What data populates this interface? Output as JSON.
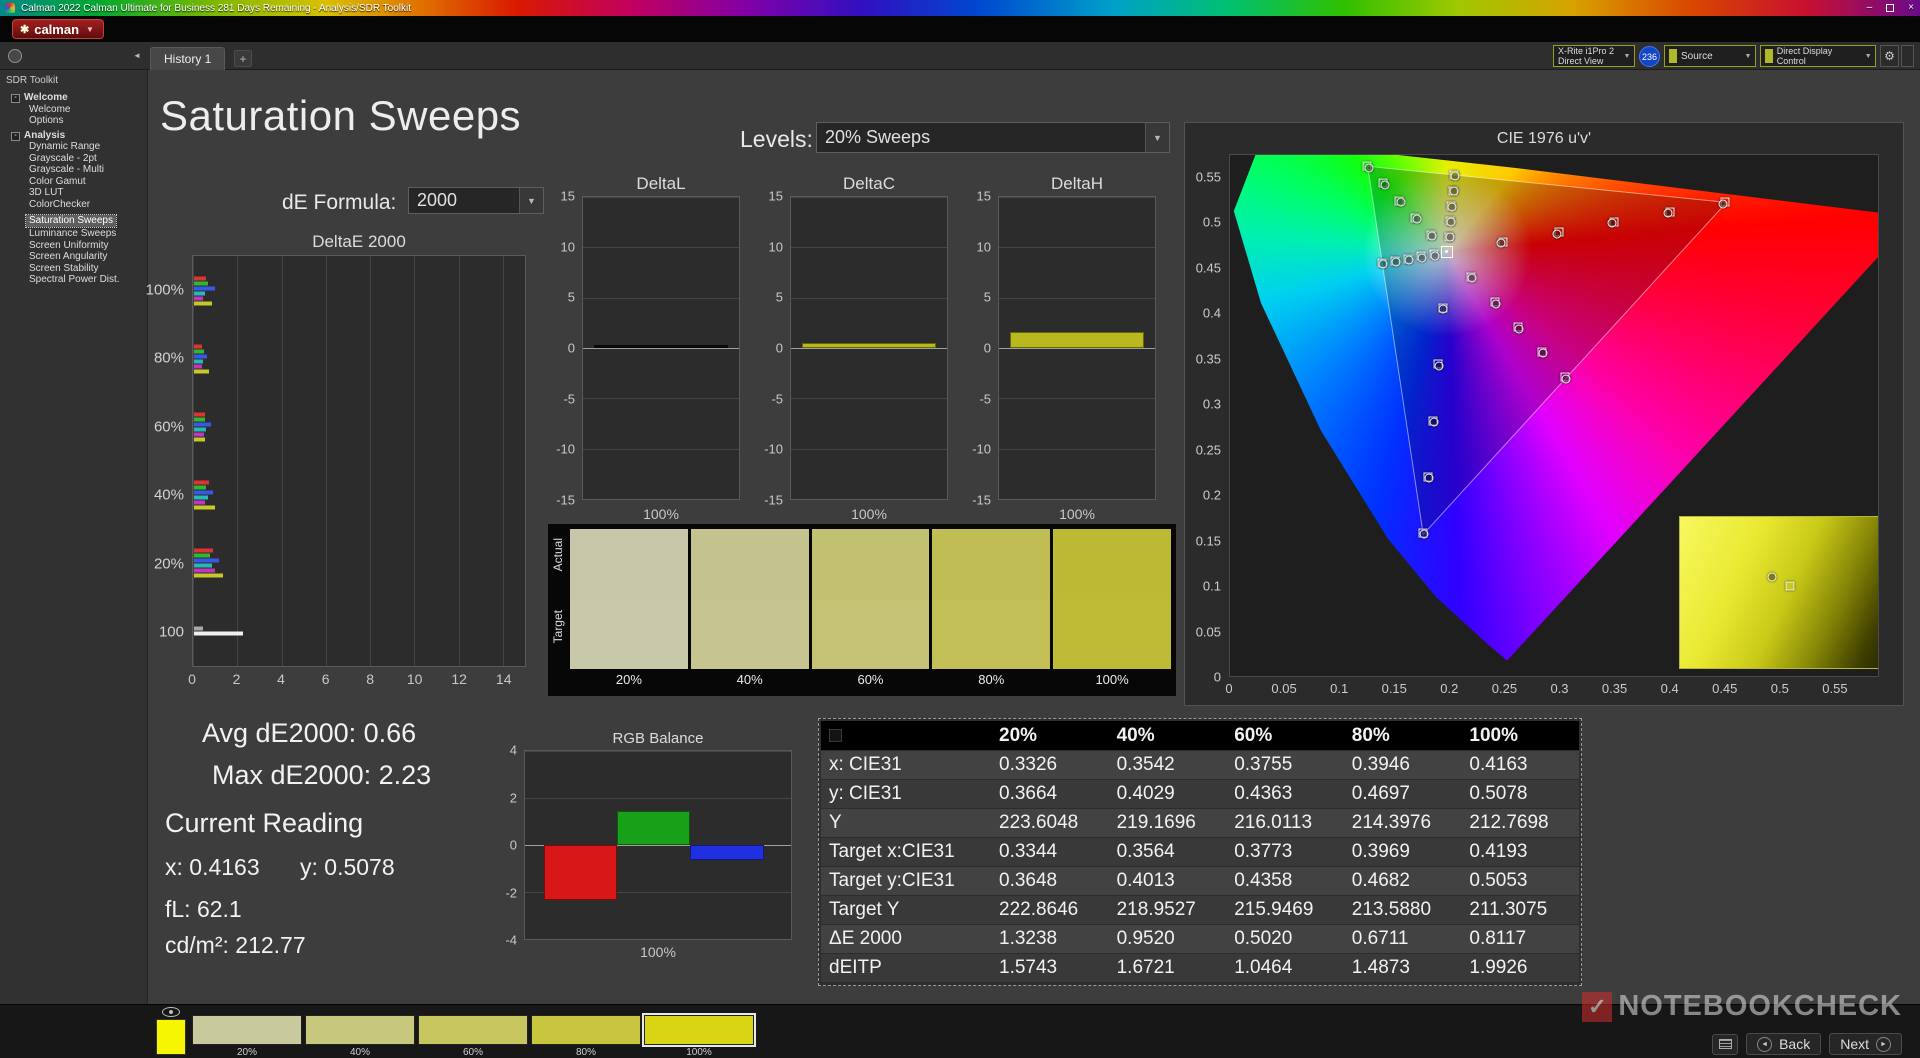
{
  "window": {
    "title": "Calman 2022 Calman Ultimate for Business 281 Days Remaining  - Analysis/SDR Toolkit",
    "logo": "calman"
  },
  "tabstrip": {
    "history_tab": "History 1",
    "add_tab": "+"
  },
  "meter_bar": {
    "meter_line1": "X-Rite i1Pro 2",
    "meter_line2": "Direct View",
    "badge": "236",
    "source": "Source",
    "display_control": "Direct Display Control"
  },
  "sidebar": {
    "header": "SDR Toolkit",
    "tree": [
      {
        "label": "Welcome",
        "level": 0,
        "selected": false
      },
      {
        "label": "Welcome",
        "level": 1,
        "selected": false
      },
      {
        "label": "Options",
        "level": 1,
        "selected": false
      },
      {
        "label": "Analysis",
        "level": 0,
        "selected": false
      },
      {
        "label": "Dynamic Range",
        "level": 1,
        "selected": false
      },
      {
        "label": "Grayscale - 2pt",
        "level": 1,
        "selected": false
      },
      {
        "label": "Grayscale - Multi",
        "level": 1,
        "selected": false
      },
      {
        "label": "Color Gamut",
        "level": 1,
        "selected": false
      },
      {
        "label": "3D LUT",
        "level": 1,
        "selected": false
      },
      {
        "label": "ColorChecker",
        "level": 1,
        "selected": false
      },
      {
        "label": "Saturation Sweeps",
        "level": 1,
        "selected": true
      },
      {
        "label": "Luminance Sweeps",
        "level": 1,
        "selected": false
      },
      {
        "label": "Screen Uniformity",
        "level": 1,
        "selected": false
      },
      {
        "label": "Screen Angularity",
        "level": 1,
        "selected": false
      },
      {
        "label": "Screen Stability",
        "level": 1,
        "selected": false
      },
      {
        "label": "Spectral Power Dist.",
        "level": 1,
        "selected": false
      }
    ]
  },
  "page": {
    "title": "Saturation Sweeps",
    "levels_label": "Levels:",
    "levels_value": "20% Sweeps",
    "de_formula_label": "dE Formula:",
    "de_formula_value": "2000"
  },
  "charts": {
    "deltaE": {
      "title": "DeltaE 2000",
      "x_ticks": [
        0,
        2,
        4,
        6,
        8,
        10,
        12,
        14
      ],
      "x_max": 15,
      "groups": [
        {
          "label": "100%",
          "bars": [
            {
              "c": "#e03434",
              "v": 0.55
            },
            {
              "c": "#30b830",
              "v": 0.62
            },
            {
              "c": "#3858e8",
              "v": 0.95
            },
            {
              "c": "#28b8b8",
              "v": 0.5
            },
            {
              "c": "#c038c0",
              "v": 0.42
            },
            {
              "c": "#c8c828",
              "v": 0.81
            }
          ]
        },
        {
          "label": "80%",
          "bars": [
            {
              "c": "#e03434",
              "v": 0.38
            },
            {
              "c": "#30b830",
              "v": 0.45
            },
            {
              "c": "#3858e8",
              "v": 0.6
            },
            {
              "c": "#28b8b8",
              "v": 0.42
            },
            {
              "c": "#c038c0",
              "v": 0.35
            },
            {
              "c": "#c8c828",
              "v": 0.67
            }
          ]
        },
        {
          "label": "60%",
          "bars": [
            {
              "c": "#e03434",
              "v": 0.52
            },
            {
              "c": "#30b830",
              "v": 0.48
            },
            {
              "c": "#3858e8",
              "v": 0.75
            },
            {
              "c": "#28b8b8",
              "v": 0.55
            },
            {
              "c": "#c038c0",
              "v": 0.44
            },
            {
              "c": "#c8c828",
              "v": 0.5
            }
          ]
        },
        {
          "label": "40%",
          "bars": [
            {
              "c": "#e03434",
              "v": 0.68
            },
            {
              "c": "#30b830",
              "v": 0.55
            },
            {
              "c": "#3858e8",
              "v": 0.88
            },
            {
              "c": "#28b8b8",
              "v": 0.62
            },
            {
              "c": "#c038c0",
              "v": 0.5
            },
            {
              "c": "#c8c828",
              "v": 0.95
            }
          ]
        },
        {
          "label": "20%",
          "bars": [
            {
              "c": "#e03434",
              "v": 0.85
            },
            {
              "c": "#30b830",
              "v": 0.72
            },
            {
              "c": "#3858e8",
              "v": 1.15
            },
            {
              "c": "#28b8b8",
              "v": 0.8
            },
            {
              "c": "#c038c0",
              "v": 0.95
            },
            {
              "c": "#c8c828",
              "v": 1.32
            }
          ]
        },
        {
          "label": "100",
          "bars": [
            {
              "c": "#a8a8a8",
              "v": 0.4
            },
            {
              "c": "#f0f0f0",
              "v": 2.23
            }
          ]
        }
      ]
    },
    "deltaL": {
      "title": "DeltaL",
      "y_ticks": [
        15,
        10,
        5,
        0,
        -5,
        -10,
        -15
      ],
      "y_max": 15,
      "x_label": "100%",
      "bars": [
        {
          "c": "#0d0d0d",
          "v": 0.25
        }
      ]
    },
    "deltaC": {
      "title": "DeltaC",
      "y_ticks": [
        15,
        10,
        5,
        0,
        -5,
        -10,
        -15
      ],
      "y_max": 15,
      "x_label": "100%",
      "bars": [
        {
          "c": "#b9b91e",
          "v": 0.45
        }
      ]
    },
    "deltaH": {
      "title": "DeltaH",
      "y_ticks": [
        15,
        10,
        5,
        0,
        -5,
        -10,
        -15
      ],
      "y_max": 15,
      "x_label": "100%",
      "bars": [
        {
          "c": "#b9b91e",
          "v": 1.6
        }
      ]
    },
    "rgb_balance": {
      "title": "RGB Balance",
      "y_ticks": [
        4,
        2,
        0,
        -2,
        -4
      ],
      "y_max": 4,
      "x_label": "100%",
      "bars": [
        {
          "c": "#d81818",
          "v": -2.35
        },
        {
          "c": "#18a018",
          "v": 1.45
        },
        {
          "c": "#2030e0",
          "v": -0.65
        }
      ]
    }
  },
  "swatch_panel": {
    "row_labels": [
      "Actual",
      "Target"
    ],
    "levels": [
      "20%",
      "40%",
      "60%",
      "80%",
      "100%"
    ],
    "actual_colors": [
      "#c6c6a8",
      "#c4c28e",
      "#c2c071",
      "#c0bd54",
      "#bcba33"
    ],
    "target_colors": [
      "#c8c8ab",
      "#c6c491",
      "#c4c274",
      "#c2bf57",
      "#bebc36"
    ]
  },
  "cie": {
    "title": "CIE 1976 u'v'",
    "x_ticks": [
      0,
      0.05,
      0.1,
      0.15,
      0.2,
      0.25,
      0.3,
      0.35,
      0.4,
      0.45,
      0.5,
      0.55
    ],
    "y_ticks": [
      0,
      0.05,
      0.1,
      0.15,
      0.2,
      0.25,
      0.3,
      0.35,
      0.4,
      0.45,
      0.5,
      0.55
    ],
    "white_point": {
      "u": 0.198,
      "v": 0.468
    },
    "targets": [
      [
        0.2486,
        0.479
      ],
      [
        0.2992,
        0.49
      ],
      [
        0.3498,
        0.501
      ],
      [
        0.4004,
        0.512
      ],
      [
        0.451,
        0.523
      ],
      [
        0.1834,
        0.4869
      ],
      [
        0.1688,
        0.5058
      ],
      [
        0.1542,
        0.5247
      ],
      [
        0.1396,
        0.5436
      ],
      [
        0.125,
        0.5625
      ],
      [
        0.1935,
        0.406
      ],
      [
        0.189,
        0.344
      ],
      [
        0.1844,
        0.2819
      ],
      [
        0.1799,
        0.2199
      ],
      [
        0.1754,
        0.1579
      ],
      [
        0.1861,
        0.4655
      ],
      [
        0.1742,
        0.4631
      ],
      [
        0.1623,
        0.4606
      ],
      [
        0.1504,
        0.4582
      ],
      [
        0.1385,
        0.4557
      ],
      [
        0.2195,
        0.4403
      ],
      [
        0.2409,
        0.4126
      ],
      [
        0.2624,
        0.3849
      ],
      [
        0.2838,
        0.3572
      ],
      [
        0.3053,
        0.3295
      ],
      [
        0.1992,
        0.485
      ],
      [
        0.2004,
        0.5019
      ],
      [
        0.2015,
        0.5189
      ],
      [
        0.2027,
        0.5358
      ],
      [
        0.2039,
        0.5528
      ]
    ],
    "measured": [
      [
        0.247,
        0.4775
      ],
      [
        0.2975,
        0.488
      ],
      [
        0.348,
        0.4995
      ],
      [
        0.399,
        0.5105
      ],
      [
        0.449,
        0.521
      ],
      [
        0.184,
        0.4855
      ],
      [
        0.17,
        0.504
      ],
      [
        0.1555,
        0.523
      ],
      [
        0.141,
        0.542
      ],
      [
        0.1265,
        0.5605
      ],
      [
        0.194,
        0.4045
      ],
      [
        0.19,
        0.3425
      ],
      [
        0.1855,
        0.2805
      ],
      [
        0.181,
        0.2185
      ],
      [
        0.1765,
        0.1565
      ],
      [
        0.187,
        0.464
      ],
      [
        0.175,
        0.4615
      ],
      [
        0.163,
        0.459
      ],
      [
        0.1515,
        0.457
      ],
      [
        0.1395,
        0.4545
      ],
      [
        0.2205,
        0.439
      ],
      [
        0.242,
        0.411
      ],
      [
        0.2635,
        0.3835
      ],
      [
        0.285,
        0.356
      ],
      [
        0.306,
        0.328
      ],
      [
        0.2,
        0.484
      ],
      [
        0.201,
        0.501
      ],
      [
        0.202,
        0.518
      ],
      [
        0.2035,
        0.535
      ],
      [
        0.2045,
        0.552
      ]
    ]
  },
  "stats": {
    "avg": "Avg dE2000: 0.66",
    "max": "Max dE2000: 2.23",
    "current_heading": "Current Reading",
    "x": "x: 0.4163",
    "y": "y: 0.5078",
    "fl": "fL: 62.1",
    "cd": "cd/m²: 212.77"
  },
  "table": {
    "columns": [
      "20%",
      "40%",
      "60%",
      "80%",
      "100%"
    ],
    "rows": [
      {
        "label": "x: CIE31",
        "values": [
          "0.3326",
          "0.3542",
          "0.3755",
          "0.3946",
          "0.4163"
        ]
      },
      {
        "label": "y: CIE31",
        "values": [
          "0.3664",
          "0.4029",
          "0.4363",
          "0.4697",
          "0.5078"
        ]
      },
      {
        "label": "Y",
        "values": [
          "223.6048",
          "219.1696",
          "216.0113",
          "214.3976",
          "212.7698"
        ]
      },
      {
        "label": "Target x:CIE31",
        "values": [
          "0.3344",
          "0.3564",
          "0.3773",
          "0.3969",
          "0.4193"
        ]
      },
      {
        "label": "Target y:CIE31",
        "values": [
          "0.3648",
          "0.4013",
          "0.4358",
          "0.4682",
          "0.5053"
        ]
      },
      {
        "label": "Target Y",
        "values": [
          "222.8646",
          "218.9527",
          "215.9469",
          "213.5880",
          "211.3075"
        ]
      },
      {
        "label": "ΔE 2000",
        "values": [
          "1.3238",
          "0.9520",
          "0.5020",
          "0.6711",
          "0.8117"
        ]
      },
      {
        "label": "dEITP",
        "values": [
          "1.5743",
          "1.6721",
          "1.0464",
          "1.4873",
          "1.9926"
        ]
      }
    ]
  },
  "bottom_bar": {
    "current_color": "#f6f600",
    "patches": [
      {
        "label": "20%",
        "color": "#c9c99e",
        "selected": false
      },
      {
        "label": "40%",
        "color": "#c7c77e",
        "selected": false
      },
      {
        "label": "60%",
        "color": "#c6c55e",
        "selected": false
      },
      {
        "label": "80%",
        "color": "#c7c63e",
        "selected": false
      },
      {
        "label": "100%",
        "color": "#d8d614",
        "selected": true
      }
    ],
    "back": "Back",
    "next": "Next"
  },
  "watermark": {
    "text": "NOTEBOOKCHECK"
  }
}
